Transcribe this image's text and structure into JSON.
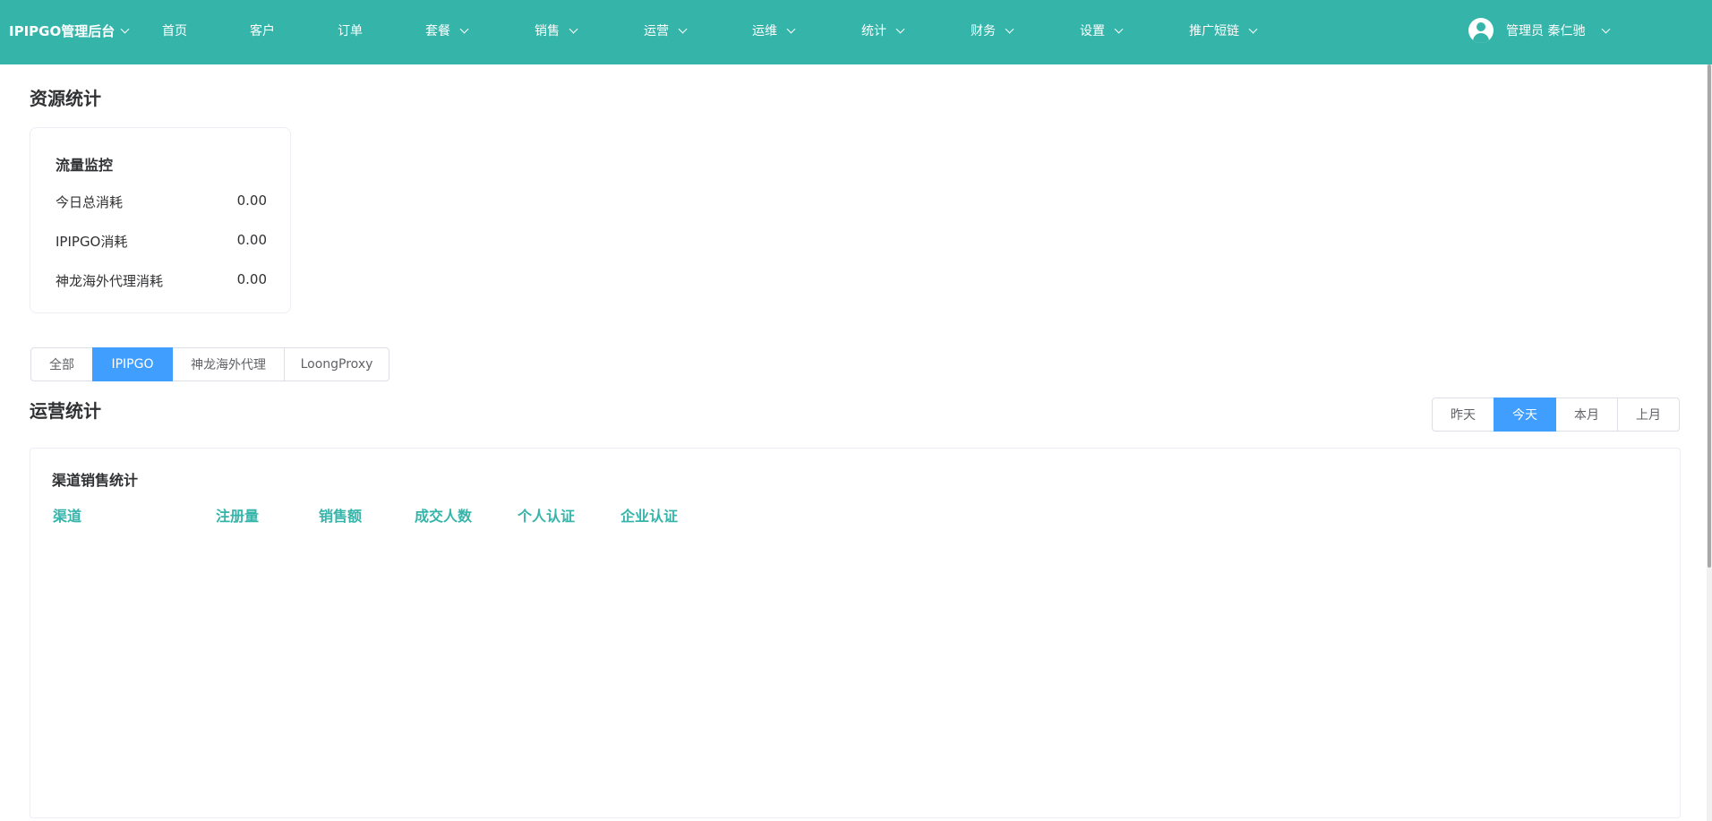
{
  "topbar": {
    "brand": "IPIPGO管理后台",
    "nav": [
      {
        "label": "首页",
        "dropdown": false
      },
      {
        "label": "客户",
        "dropdown": false
      },
      {
        "label": "订单",
        "dropdown": false
      },
      {
        "label": "套餐",
        "dropdown": true
      },
      {
        "label": "销售",
        "dropdown": true
      },
      {
        "label": "运营",
        "dropdown": true
      },
      {
        "label": "运维",
        "dropdown": true
      },
      {
        "label": "统计",
        "dropdown": true
      },
      {
        "label": "财务",
        "dropdown": true
      },
      {
        "label": "设置",
        "dropdown": true
      },
      {
        "label": "推广短链",
        "dropdown": true
      }
    ],
    "user": "管理员 秦仁驰",
    "bg_color": "#35b5aa"
  },
  "resource": {
    "title": "资源统计",
    "card": {
      "title": "流量监控",
      "rows": [
        {
          "label": "今日总消耗",
          "value": "0.00"
        },
        {
          "label": "IPIPGO消耗",
          "value": "0.00"
        },
        {
          "label": "神龙海外代理消耗",
          "value": "0.00"
        }
      ]
    }
  },
  "product_tabs": {
    "items": [
      "全部",
      "IPIPGO",
      "神龙海外代理",
      "LoongProxy"
    ],
    "active": "IPIPGO"
  },
  "operations": {
    "title": "运营统计",
    "periods": [
      "昨天",
      "今天",
      "本月",
      "上月"
    ],
    "active_period": "今天",
    "active_color": "#409eff"
  },
  "channel_sales": {
    "title": "渠道销售统计",
    "columns": [
      "渠道",
      "注册量",
      "销售额",
      "成交人数",
      "个人认证",
      "企业认证"
    ],
    "rows": []
  }
}
